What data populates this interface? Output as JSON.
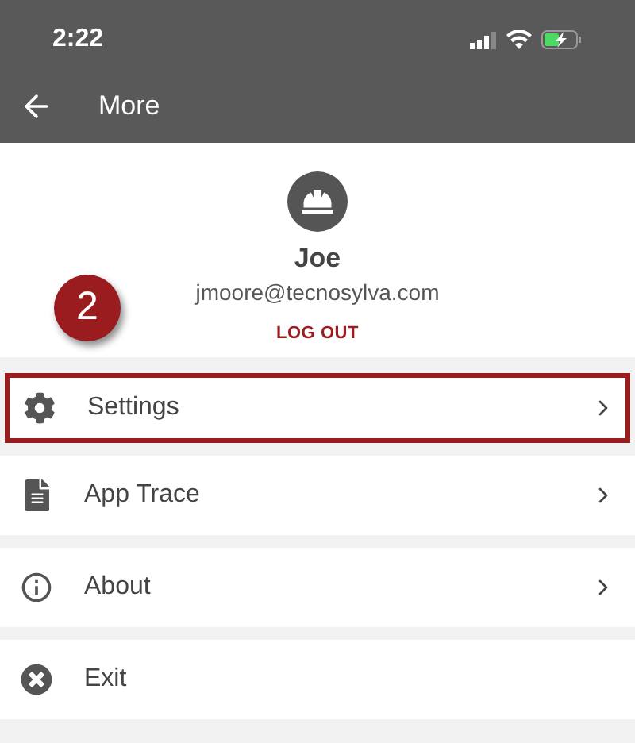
{
  "status_bar": {
    "time": "2:22"
  },
  "header": {
    "title": "More"
  },
  "profile": {
    "name": "Joe",
    "email": "jmoore@tecnosylva.com",
    "logout": "LOG OUT"
  },
  "callout": {
    "label": "2"
  },
  "menu": [
    {
      "label": "Settings",
      "kind": "settings",
      "chevron": true,
      "highlighted": true
    },
    {
      "label": "App Trace",
      "kind": "document",
      "chevron": true,
      "highlighted": false
    },
    {
      "label": "About",
      "kind": "info",
      "chevron": true,
      "highlighted": false
    },
    {
      "label": "Exit",
      "kind": "exit",
      "chevron": false,
      "highlighted": false
    }
  ]
}
